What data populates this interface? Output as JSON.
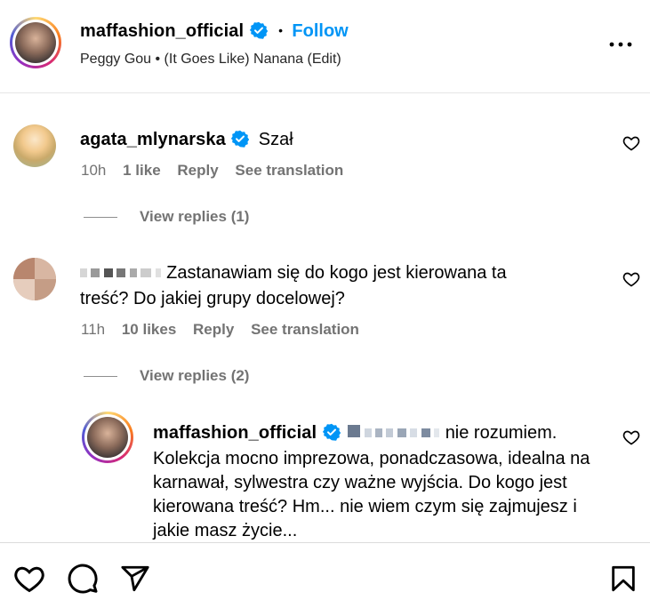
{
  "header": {
    "username": "maffashion_official",
    "dot": "•",
    "follow_label": "Follow",
    "audio": "Peggy Gou • (It Goes Like) Nanana (Edit)",
    "more_icon": "more-horizontal-icon"
  },
  "comments": [
    {
      "username": "agata_mlynarska",
      "verified": true,
      "text": "Szał",
      "time": "10h",
      "likes": "1 like",
      "reply_label": "Reply",
      "translate_label": "See translation",
      "view_replies": "View replies (1)"
    },
    {
      "username_hidden": true,
      "text_line1": "Zastanawiam się do kogo jest kierowana ta",
      "text_line2": "treść? Do jakiej grupy docelowej?",
      "time": "11h",
      "likes": "10 likes",
      "reply_label": "Reply",
      "translate_label": "See translation",
      "view_replies": "View replies (2)"
    }
  ],
  "reply": {
    "username": "maffashion_official",
    "verified": true,
    "text_line1_tail": "nie rozumiem.",
    "text_line2": "Kolekcja mocno imprezowa, ponadczasowa, idealna na",
    "text_line3": "karnawał, sylwestra czy ważne wyjścia. Do kogo jest",
    "text_line4": "kierowana treść? Hm... nie wiem czym się zajmujesz i",
    "text_line5": "jakie masz życie..."
  },
  "footer": {
    "icons": [
      "heart-icon",
      "comment-icon",
      "share-icon",
      "bookmark-icon"
    ]
  },
  "colors": {
    "accent": "#0095f6",
    "verified": "#0095f6",
    "muted": "#737373"
  }
}
